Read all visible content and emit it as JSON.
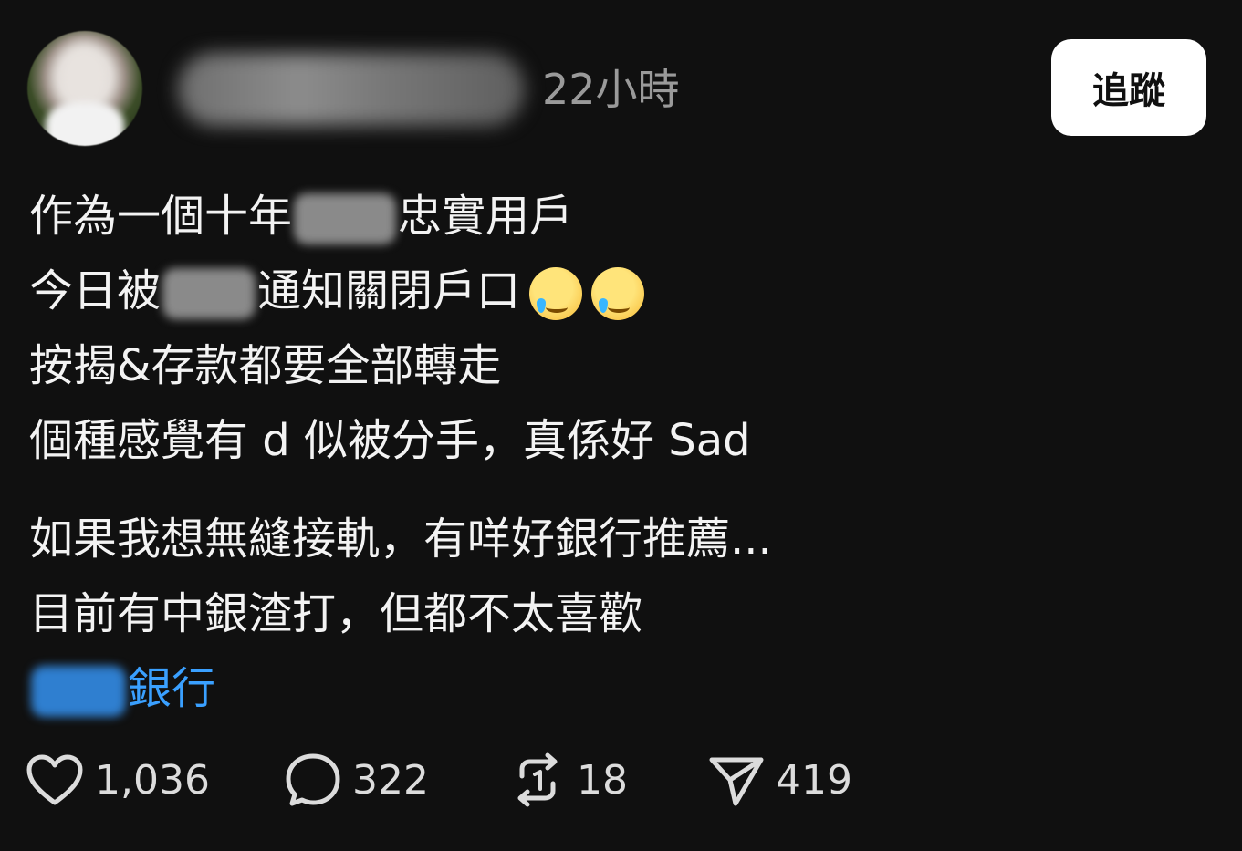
{
  "post": {
    "timestamp": "22小時",
    "follow_label": "追蹤",
    "lines": [
      {
        "before": "作為一個十年",
        "after": "忠實用戶"
      },
      {
        "before": "今日被",
        "after": "通知關閉戶口"
      },
      {
        "text": "按揭&存款都要全部轉走"
      },
      {
        "text": "個種感覺有 d 似被分手，真係好 Sad"
      },
      {
        "text": "如果我想無縫接軌，有咩好銀行推薦..."
      },
      {
        "text": "目前有中銀渣打，但都不太喜歡"
      },
      {
        "after": "銀行"
      }
    ],
    "emoji": "smiling-face-with-tear"
  },
  "metrics": {
    "likes": "1,036",
    "comments": "322",
    "reposts": "18",
    "shares": "419"
  },
  "colors": {
    "background": "#101010",
    "link": "#3aa0ff",
    "muted": "#9a9a9a"
  }
}
